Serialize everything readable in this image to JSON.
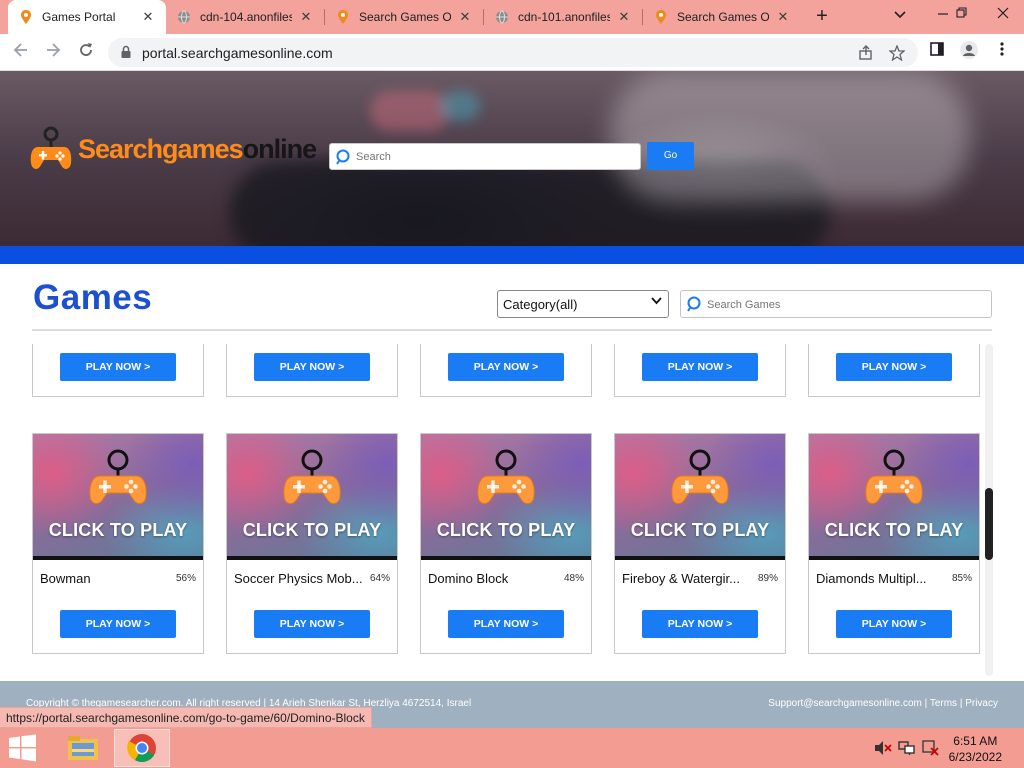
{
  "browser": {
    "tabs": [
      {
        "title": "Games Portal",
        "active": true,
        "icon": "pin-icon"
      },
      {
        "title": "cdn-104.anonfiles",
        "active": false,
        "icon": "globe-icon"
      },
      {
        "title": "Search Games On",
        "active": false,
        "icon": "pin-icon"
      },
      {
        "title": "cdn-101.anonfiles",
        "active": false,
        "icon": "globe-icon"
      },
      {
        "title": "Search Games On",
        "active": false,
        "icon": "pin-icon"
      }
    ],
    "close_glyph": "✕",
    "new_tab": "+",
    "url": "portal.searchgamesonline.com"
  },
  "site": {
    "logo_part1": "Searchgames",
    "logo_part2": "online",
    "search_placeholder": "Search",
    "go_label": "Go",
    "games_title": "Games",
    "category_value": "Category(all)",
    "games_search_placeholder": "Search Games",
    "play_label": "PLAY NOW >",
    "click_to_play": "CLICK TO PLAY",
    "games": [
      {
        "name": "Bowman",
        "pct": "56%"
      },
      {
        "name": "Soccer Physics Mob...",
        "pct": "64%"
      },
      {
        "name": "Domino Block",
        "pct": "48%"
      },
      {
        "name": "Fireboy & Watergir...",
        "pct": "89%"
      },
      {
        "name": "Diamonds Multipl...",
        "pct": "85%"
      }
    ],
    "footer_copy": "Copyright © thegamesearcher.com. All right reserved | 14 Arieh Shenkar St, Herzliya 4672514, Israel",
    "footer_links": "Support@searchgamesonline.com | Terms | Privacy"
  },
  "status_url": "https://portal.searchgamesonline.com/go-to-game/60/Domino-Block",
  "taskbar": {
    "time": "6:51 AM",
    "date": "6/23/2022"
  },
  "colors": {
    "accent_blue": "#1a7cf5",
    "title_blue": "#1d4fd1",
    "logo_orange": "#ff8c1a",
    "chrome_pink": "#f3a39b"
  }
}
